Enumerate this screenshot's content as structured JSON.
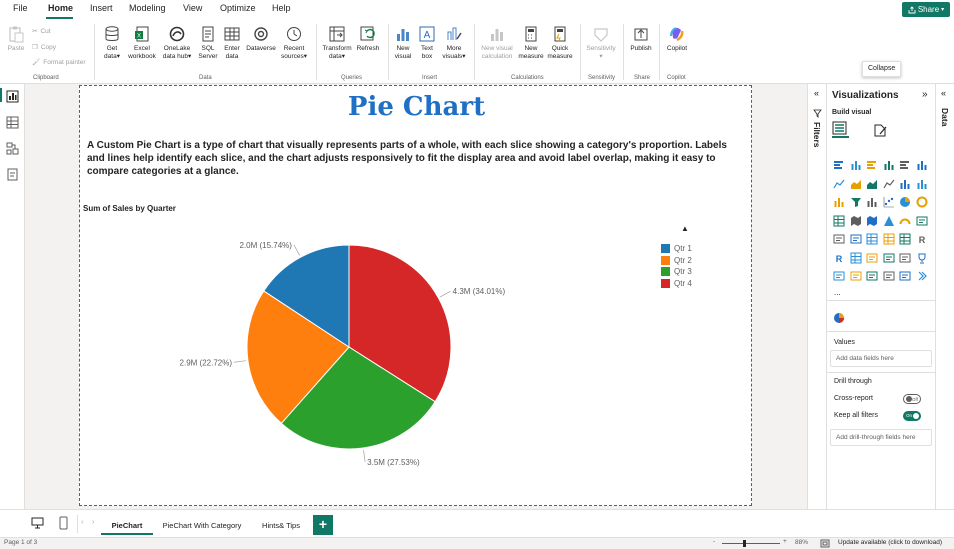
{
  "menu": {
    "items": [
      "File",
      "Home",
      "Insert",
      "Modeling",
      "View",
      "Optimize",
      "Help"
    ],
    "active": "Home",
    "share_label": "Share"
  },
  "ribbon": {
    "clipboard": {
      "paste": "Paste",
      "cut": "Cut",
      "copy": "Copy",
      "format_painter": "Format painter",
      "label": "Clipboard"
    },
    "data": {
      "get_data": [
        "Get",
        "data"
      ],
      "excel": [
        "Excel",
        "workbook"
      ],
      "onelake": [
        "OneLake",
        "data hub"
      ],
      "sql": [
        "SQL",
        "Server"
      ],
      "enter": [
        "Enter",
        "data"
      ],
      "dataverse": "Dataverse",
      "recent": [
        "Recent",
        "sources"
      ],
      "label": "Data"
    },
    "queries": {
      "transform": [
        "Transform",
        "data"
      ],
      "refresh": "Refresh",
      "label": "Queries"
    },
    "insert": {
      "new_visual": [
        "New",
        "visual"
      ],
      "text_box": [
        "Text",
        "box"
      ],
      "more_visuals": [
        "More",
        "visuals"
      ],
      "label": "Insert"
    },
    "calculations": {
      "new_visual_calc": [
        "New visual",
        "calculation"
      ],
      "new_measure": [
        "New",
        "measure"
      ],
      "quick_measure": [
        "Quick",
        "measure"
      ],
      "label": "Calculations"
    },
    "sensitivity": {
      "button": "Sensitivity",
      "label": "Sensitivity"
    },
    "share": {
      "publish": "Publish",
      "label": "Share"
    },
    "copilot": {
      "button": "Copilot",
      "label": "Copilot"
    }
  },
  "report": {
    "title": "Pie Chart",
    "description": "A Custom Pie Chart is a type of chart that visually represents parts of a whole, with each slice showing a category's proportion. Labels and lines help identify each slice, and the chart adjusts responsively to fit the display area and avoid label overlap, making it easy to compare categories at a glance.",
    "visual_title": "Sum of Sales by Quarter",
    "legend_arrow": "▲"
  },
  "chart_data": {
    "type": "pie",
    "title": "Sum of Sales by Quarter",
    "categories": [
      "Qtr 1",
      "Qtr 2",
      "Qtr 3",
      "Qtr 4"
    ],
    "values": [
      15.74,
      22.72,
      27.53,
      34.01
    ],
    "labels": [
      "2.0M (15.74%)",
      "2.9M (22.72%)",
      "3.5M (27.53%)",
      "4.3M (34.01%)"
    ],
    "colors": [
      "#1f77b4",
      "#ff7f0e",
      "#2ca02c",
      "#d62728"
    ],
    "legend": "right"
  },
  "panes": {
    "collapse_tooltip": "Collapse",
    "filters_label": "Filters",
    "data_label": "Data",
    "visualizations_title": "Visualizations",
    "build_visual": "Build visual",
    "more": "...",
    "values_label": "Values",
    "values_placeholder": "Add data fields here",
    "drill_through": "Drill through",
    "cross_report": "Cross-report",
    "cross_report_state": "Off",
    "keep_all_filters": "Keep all filters",
    "keep_all_filters_state": "On",
    "drill_placeholder": "Add drill-through fields here"
  },
  "tabs": {
    "pages": [
      "PieChart",
      "PieChart With Category",
      "Hints& Tips"
    ],
    "active": "PieChart",
    "add": "+"
  },
  "status": {
    "page": "Page 1 of 3",
    "zoom": "88%",
    "update": "Update available (click to download)",
    "minus": "-",
    "plus": "+"
  }
}
